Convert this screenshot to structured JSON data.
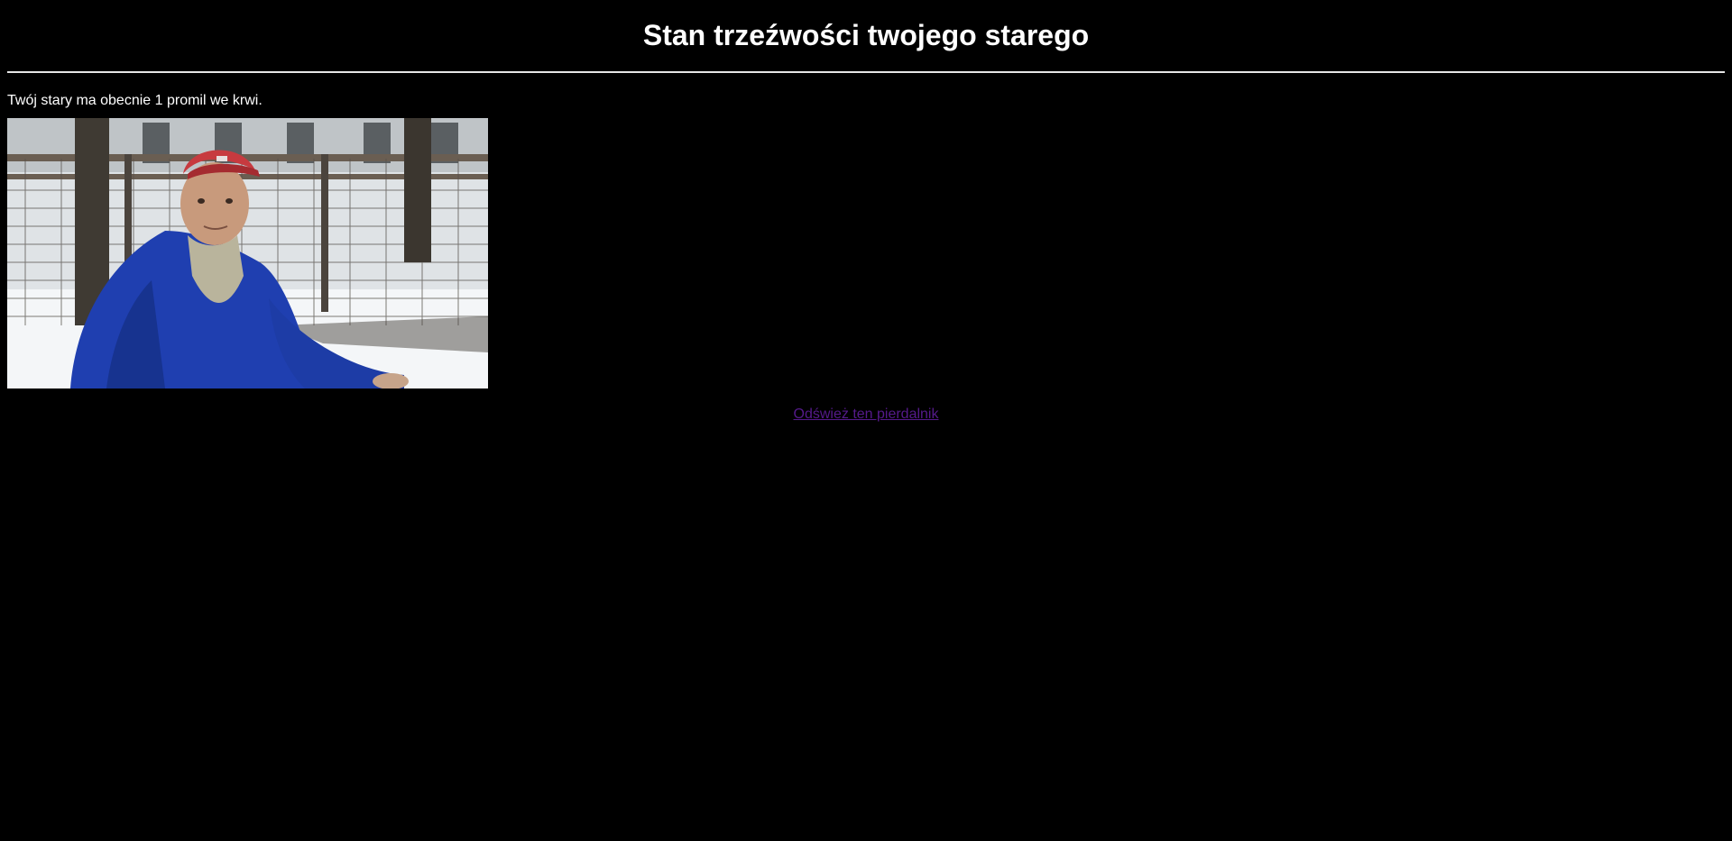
{
  "header": {
    "title": "Stan trzeźwości twojego starego"
  },
  "main": {
    "status_text": "Twój stary ma obecnie 1 promil we krwi.",
    "photo": {
      "description_icon": "photo-of-man-in-blue-jacket-and-red-cap-in-snow"
    },
    "refresh_link_label": "Odśwież ten pierdalnik"
  },
  "colors": {
    "background": "#000000",
    "text": "#ffffff",
    "visited_link": "#551a8b"
  }
}
